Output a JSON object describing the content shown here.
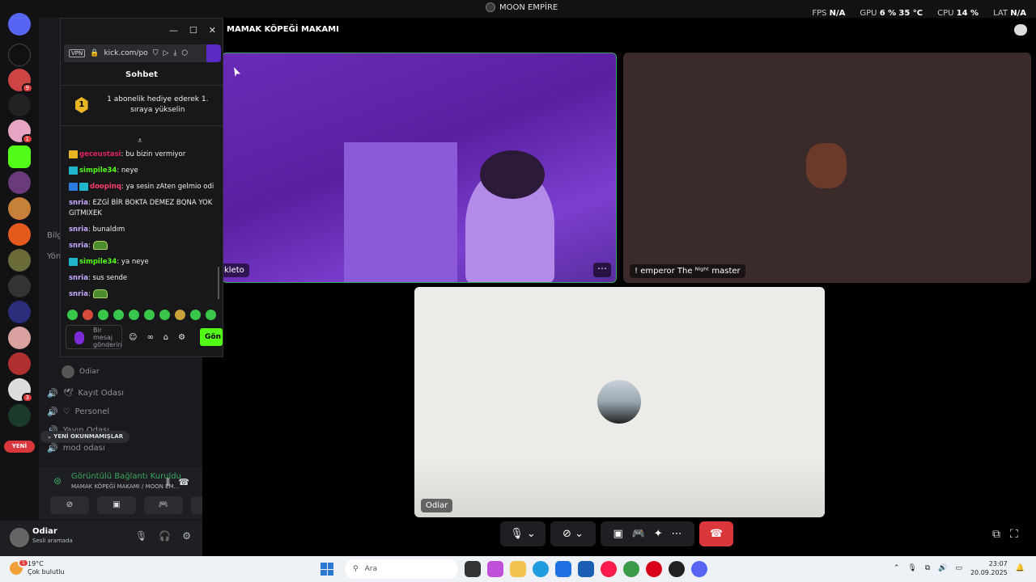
{
  "window": {
    "title": "MOON EMPİRE"
  },
  "perf": {
    "fps_label": "FPS",
    "fps_value": "N/A",
    "gpu_label": "GPU",
    "gpu_value": "6 %",
    "temp_value": "35 °C",
    "cpu_label": "CPU",
    "cpu_value": "14 %",
    "lat_label": "LAT",
    "lat_value": "N/A"
  },
  "guilds": {
    "badges": [
      "9",
      "1",
      "3"
    ],
    "new_label": "YENİ"
  },
  "channels": {
    "items": [
      {
        "label": "Kayıt Odası",
        "prefix": "🕊"
      },
      {
        "label": "Personel",
        "prefix": "♡"
      },
      {
        "label": "Yayın Odası",
        "prefix": ""
      },
      {
        "label": "mod odası",
        "prefix": ""
      }
    ],
    "sub_user": "Odiar",
    "unread_label": "⌄ YENİ OKUNMAMIŞLAR",
    "partial_bilg": "Bilg",
    "partial_yon": "Yön"
  },
  "voice": {
    "status": "Görüntülü Bağlantı Kuruldu",
    "location": "MAMAK KÖPEĞİ MAKAMI / MOON EM..."
  },
  "user": {
    "name": "Odiar",
    "status": "Sesli aramada"
  },
  "stage": {
    "channel_title": "MAMAK KÖPEĞİ MAKAMI",
    "tiles": [
      {
        "label": "kleto"
      },
      {
        "label": "! emperor The ᴺⁱᵍʰᵗ master"
      },
      {
        "label": "Odiar"
      }
    ]
  },
  "popup": {
    "url": "kick.com/po",
    "vpn": "VPN",
    "chat_title": "Sohbet",
    "gift_rank": "1",
    "gift_text": "1 abonelik hediye ederek 1. sıraya yükselin",
    "input_placeholder": "Bir mesaj gönderin",
    "send_label": "Gön",
    "messages": [
      {
        "user": "geceustasi",
        "color": "#e0245e",
        "text": ": bu bizin vermiyor",
        "badges": [
          "#e8b423"
        ]
      },
      {
        "user": "simpile34",
        "color": "#53fc18",
        "text": ": neye",
        "badges": [
          "#1fb6c9"
        ]
      },
      {
        "user": "doopinq",
        "color": "#ff3b6b",
        "text": ": ya sesin zAten gelmio odi",
        "badges": [
          "#2b7be0",
          "#1fb6c9"
        ]
      },
      {
        "user": "snria",
        "color": "#c7a8ff",
        "text": ": EZGİ BİR BOKTA DEMEZ BQNA YOK GITMIXEK",
        "badges": []
      },
      {
        "user": "snria",
        "color": "#c7a8ff",
        "text": ": bunaldım",
        "badges": []
      },
      {
        "user": "snria",
        "color": "#c7a8ff",
        "text": ":",
        "badges": [],
        "emote": true
      },
      {
        "user": "simpile34",
        "color": "#53fc18",
        "text": ": ya neye",
        "badges": [
          "#1fb6c9"
        ]
      },
      {
        "user": "snria",
        "color": "#c7a8ff",
        "text": ": sus sende",
        "badges": []
      },
      {
        "user": "snria",
        "color": "#c7a8ff",
        "text": ":",
        "badges": [],
        "emote": true
      }
    ]
  },
  "taskbar": {
    "temp": "19°C",
    "weather": "Çok bulutlu",
    "search": "Ara",
    "time": "23:07",
    "date": "20.09.2025",
    "weather_badge": "1"
  }
}
